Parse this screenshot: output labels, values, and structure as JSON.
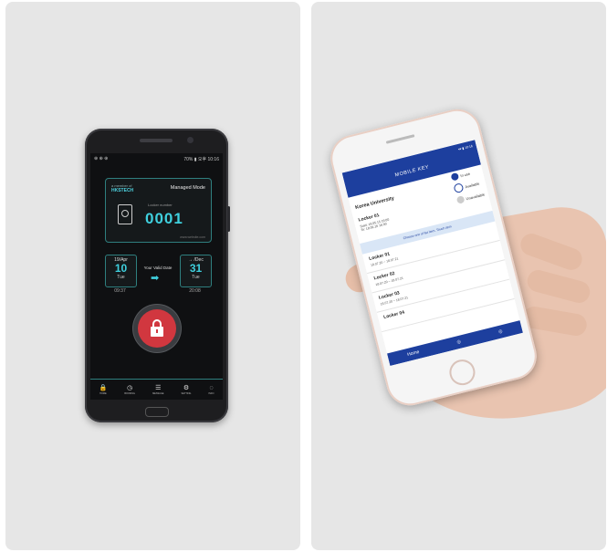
{
  "left": {
    "status": {
      "left": "⊕ ⊕ ⊕",
      "right": "70% ▮ 오후 10:16"
    },
    "card": {
      "brand_top": "a member of",
      "brand_name": "HKSTECH",
      "mode": "Managed Mode",
      "number_label": "Locker number",
      "number": "0001",
      "footer": "www.website.com"
    },
    "from": {
      "top": "19/Apr",
      "day": "10",
      "dow": "Tue",
      "time": "09:37"
    },
    "to": {
      "top": "→ /Dec",
      "day": "31",
      "dow": "Tue",
      "time": "20:08"
    },
    "valid_label": "Your Valid Date",
    "nav": [
      {
        "icon": "lock-icon",
        "glyph": "🔒",
        "label": "HOME"
      },
      {
        "icon": "clock-icon",
        "glyph": "◷",
        "label": "BOOKING"
      },
      {
        "icon": "list-icon",
        "glyph": "☰",
        "label": "MESSAGE"
      },
      {
        "icon": "gear-icon",
        "glyph": "⚙",
        "label": "SETTING"
      },
      {
        "icon": "chat-icon",
        "glyph": "◌",
        "label": "INFO"
      }
    ]
  },
  "right": {
    "status": "▾▾ ▮ 10:16",
    "title": "MOBILE KEY",
    "organization": "Korea University",
    "legend": [
      {
        "label": "In use",
        "color": "#1d3f9e"
      },
      {
        "label": "Available",
        "color": "#ffffff"
      },
      {
        "label": "Unavailable",
        "color": "#cccccc"
      }
    ],
    "current_locker": "Locker 01",
    "current_times": [
      "Start: 18.05.15 16:00",
      "To: 18.06.16 16:00"
    ],
    "banner": "Choose one of list item. Touch item",
    "lockers": [
      {
        "name": "Locker 01",
        "time": "18.07.20 ~ 18.07.21"
      },
      {
        "name": "Locker 02",
        "time": "18.07.20 ~ 18.07.21"
      },
      {
        "name": "Locker 03",
        "time": "18.07.20 ~ 18.07.21"
      },
      {
        "name": "Locker 04",
        "time": ""
      }
    ],
    "nav": [
      "Home",
      "◎",
      "◎"
    ]
  }
}
